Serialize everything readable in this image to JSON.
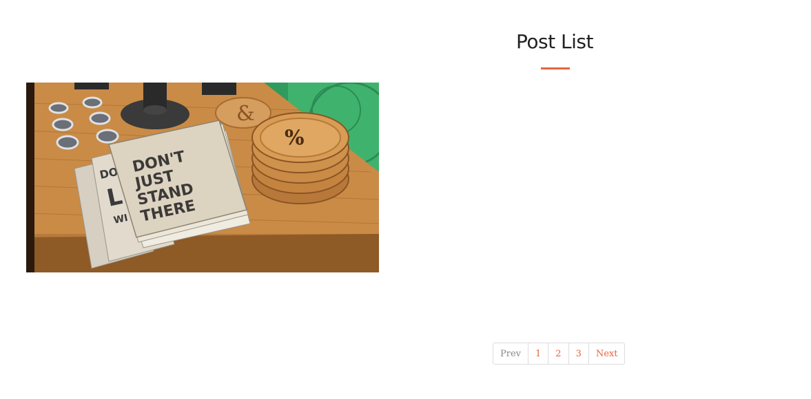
{
  "header": {
    "title": "Post List"
  },
  "post": {
    "image_alt": "Notebooks and wooden coasters on a desk",
    "notebook_text": [
      "DON'T",
      "JUST",
      "STAND",
      "THERE"
    ],
    "coaster_text": "%"
  },
  "pagination": {
    "prev": "Prev",
    "pages": [
      "1",
      "2",
      "3"
    ],
    "next": "Next"
  },
  "colors": {
    "accent": "#e8643d"
  }
}
